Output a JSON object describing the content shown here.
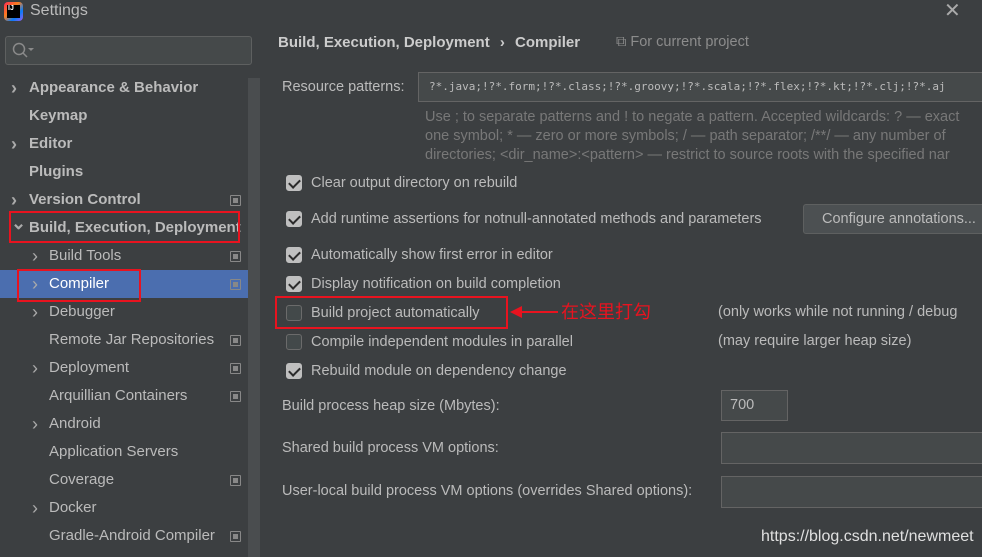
{
  "window": {
    "title": "Settings",
    "close_icon": "close-icon",
    "app_icon": "intellij-idea-icon",
    "app_icon_text": "IJ"
  },
  "search": {
    "placeholder": "",
    "icon": "search-icon"
  },
  "sidebar": {
    "items": [
      {
        "label": "Appearance & Behavior",
        "bold": true,
        "expandable": true,
        "expanded": false
      },
      {
        "label": "Keymap",
        "bold": true
      },
      {
        "label": "Editor",
        "bold": true,
        "expandable": true,
        "expanded": false
      },
      {
        "label": "Plugins",
        "bold": true
      },
      {
        "label": "Version Control",
        "bold": true,
        "expandable": true,
        "expanded": false,
        "project_icon": true
      },
      {
        "label": "Build, Execution, Deployment",
        "bold": true,
        "expandable": true,
        "expanded": true
      },
      {
        "label": "Build Tools",
        "expandable": true,
        "project_icon": true
      },
      {
        "label": "Compiler",
        "expandable": true,
        "selected": true,
        "project_icon": true
      },
      {
        "label": "Debugger",
        "expandable": true
      },
      {
        "label": "Remote Jar Repositories",
        "project_icon": true
      },
      {
        "label": "Deployment",
        "expandable": true,
        "project_icon": true
      },
      {
        "label": "Arquillian Containers",
        "project_icon": true
      },
      {
        "label": "Android",
        "expandable": true
      },
      {
        "label": "Application Servers"
      },
      {
        "label": "Coverage",
        "project_icon": true
      },
      {
        "label": "Docker",
        "expandable": true
      },
      {
        "label": "Gradle-Android Compiler",
        "project_icon": true
      }
    ]
  },
  "breadcrumb": {
    "parent": "Build, Execution, Deployment",
    "separator": "›",
    "current": "Compiler",
    "scope": "For current project"
  },
  "resource_patterns": {
    "label": "Resource patterns:",
    "value": "?*.java;!?*.form;!?*.class;!?*.groovy;!?*.scala;!?*.flex;!?*.kt;!?*.clj;!?*.aj",
    "help": [
      "Use ; to separate patterns and ! to negate a pattern. Accepted wildcards: ? — exact",
      "one symbol; * — zero or more symbols; / — path separator; /**/ — any number of",
      "directories; <dir_name>:<pattern> — restrict to source roots with the specified nar"
    ]
  },
  "options": [
    {
      "label": "Clear output directory on rebuild",
      "checked": true
    },
    {
      "label": "Add runtime assertions for notnull-annotated methods and parameters",
      "checked": true
    },
    {
      "label": "Automatically show first error in editor",
      "checked": true
    },
    {
      "label": "Display notification on build completion",
      "checked": true
    },
    {
      "label": "Build project automatically",
      "checked": false,
      "note": "(only works while not running / debug"
    },
    {
      "label": "Compile independent modules in parallel",
      "checked": false,
      "note": "(may require larger heap size)"
    },
    {
      "label": "Rebuild module on dependency change",
      "checked": true
    }
  ],
  "configure_button": "Configure annotations...",
  "heap": {
    "label": "Build process heap size (Mbytes):",
    "value": "700"
  },
  "shared_vm": {
    "label": "Shared build process VM options:",
    "value": ""
  },
  "local_vm": {
    "label": "User-local build process VM options (overrides Shared options):",
    "value": ""
  },
  "annotation": {
    "text": "在这里打勾",
    "color": "#e8131f"
  },
  "watermark": "https://blog.csdn.net/newmeet",
  "colors": {
    "background": "#3c3f41",
    "selection": "#4b6eaf",
    "highlight": "#e8131f"
  }
}
